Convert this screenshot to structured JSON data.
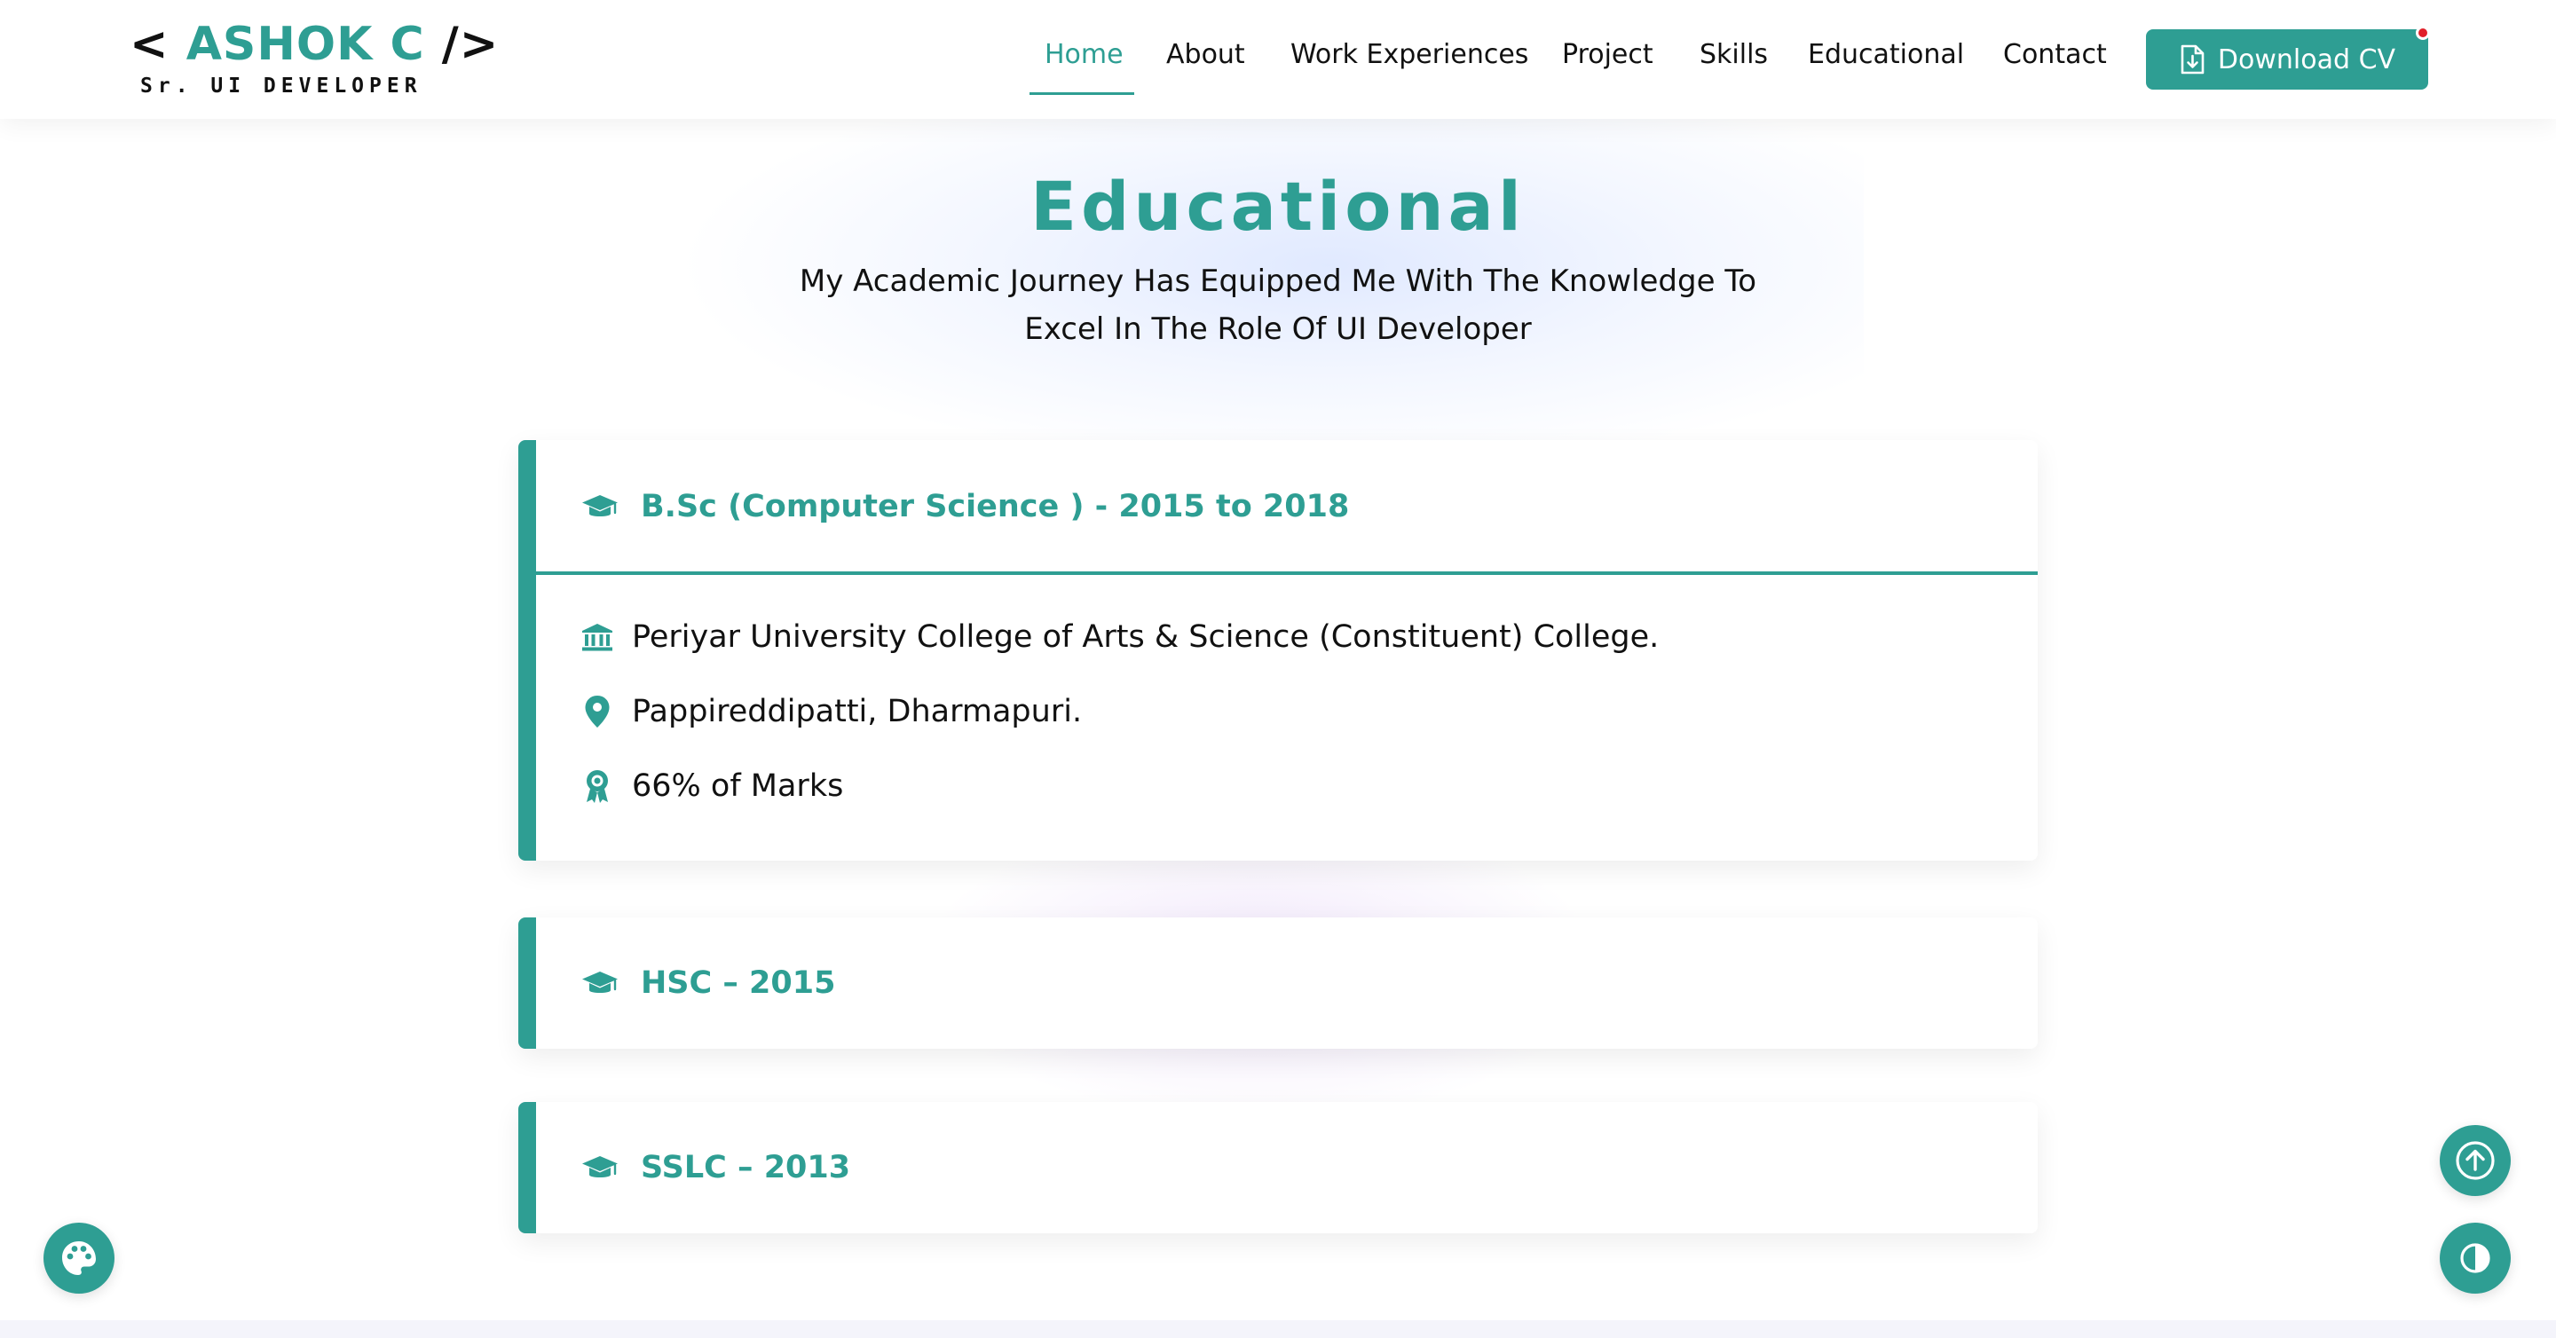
{
  "header": {
    "logo": {
      "bracket_open": "<",
      "name": "ASHOK C",
      "bracket_close": "/>",
      "subtitle": "Sr. UI DEVELOPER"
    },
    "nav": [
      "Home",
      "About",
      "Work Experiences",
      "Project",
      "Skills",
      "Educational",
      "Contact"
    ],
    "active_nav": "Home",
    "cv_button": "Download CV"
  },
  "section": {
    "title": "Educational",
    "subtitle_line1": "My Academic Journey Has Equipped Me With The Knowledge To",
    "subtitle_line2": "Excel In The Role Of UI Developer"
  },
  "education": [
    {
      "title": "B.Sc (Computer Science ) - 2015 to 2018",
      "expanded": true,
      "institution": "Periyar University College of Arts & Science (Constituent) College.",
      "location": "Pappireddipatti, Dharmapuri.",
      "marks": "66% of Marks"
    },
    {
      "title": "HSC – 2015",
      "expanded": false
    },
    {
      "title": "SSLC – 2013",
      "expanded": false
    }
  ],
  "icons": {
    "graduation": "graduation-cap-icon",
    "institution": "university-icon",
    "location": "map-pin-icon",
    "marks": "award-icon",
    "download": "file-download-icon",
    "palette": "palette-icon",
    "scroll_top": "arrow-up-circle-icon",
    "theme": "contrast-icon"
  },
  "colors": {
    "accent": "#2e9e93",
    "text": "#111111",
    "notification_dot": "#e0202a"
  }
}
